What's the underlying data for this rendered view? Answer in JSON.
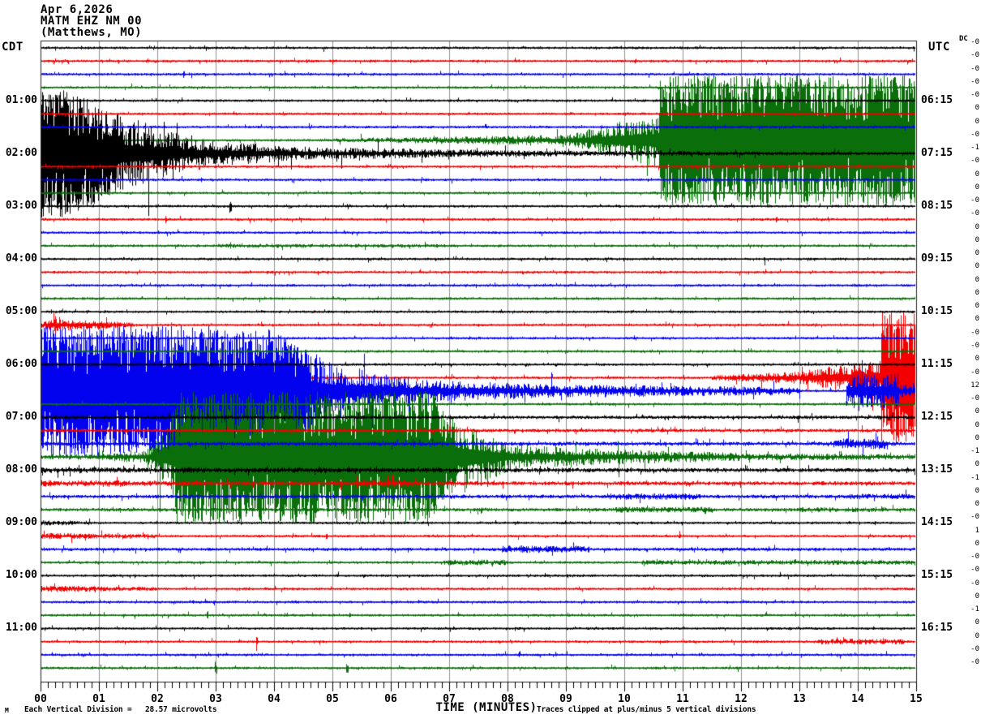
{
  "header": {
    "date": "Apr 6,2026",
    "station": "MATM EHZ NM 00",
    "location": "(Matthews, MO)"
  },
  "axes": {
    "left_timezone": "CDT",
    "right_timezone": "UTC",
    "dc_header": "DC",
    "left_labels": [
      {
        "row": 4,
        "text": "01:00"
      },
      {
        "row": 8,
        "text": "02:00"
      },
      {
        "row": 12,
        "text": "03:00"
      },
      {
        "row": 16,
        "text": "04:00"
      },
      {
        "row": 20,
        "text": "05:00"
      },
      {
        "row": 24,
        "text": "06:00"
      },
      {
        "row": 28,
        "text": "07:00"
      },
      {
        "row": 32,
        "text": "08:00"
      },
      {
        "row": 36,
        "text": "09:00"
      },
      {
        "row": 40,
        "text": "10:00"
      },
      {
        "row": 44,
        "text": "11:00"
      }
    ],
    "right_labels": [
      {
        "row": 4,
        "text": "06:15"
      },
      {
        "row": 8,
        "text": "07:15"
      },
      {
        "row": 12,
        "text": "08:15"
      },
      {
        "row": 16,
        "text": "09:15"
      },
      {
        "row": 20,
        "text": "10:15"
      },
      {
        "row": 24,
        "text": "11:15"
      },
      {
        "row": 28,
        "text": "12:15"
      },
      {
        "row": 32,
        "text": "13:15"
      },
      {
        "row": 36,
        "text": "14:15"
      },
      {
        "row": 40,
        "text": "15:15"
      },
      {
        "row": 44,
        "text": "16:15"
      }
    ],
    "x_labels": [
      "00",
      "01",
      "02",
      "03",
      "04",
      "05",
      "06",
      "07",
      "08",
      "09",
      "10",
      "11",
      "12",
      "13",
      "14",
      "15"
    ],
    "x_title": "TIME (MINUTES)"
  },
  "footer": {
    "logo_mark": "M",
    "left_note": "Each Vertical Division =   28.57 microvolts",
    "right_note": "Traces clipped at plus/minus 5 vertical divisions"
  },
  "chart_data": {
    "type": "line",
    "variant": "helicorder-seismogram",
    "title": "MATM EHZ NM 00 (Matthews, MO) Apr 6,2026",
    "xlabel": "TIME (MINUTES)",
    "x_range_minutes": [
      0,
      15
    ],
    "minutes_per_row": 15,
    "rows_count": 48,
    "row_cycle_colors": [
      "black",
      "red",
      "blue",
      "green"
    ],
    "colors": {
      "black": "#000000",
      "red": "#f40000",
      "blue": "#0202ee",
      "green": "#0a6e0a",
      "grid": "#8f8f8f",
      "border": "#222222"
    },
    "clip_divisions": 5,
    "microvolts_per_division": 28.57,
    "rows": [
      {
        "dc": "-0",
        "spikes": [
          [
            10.2,
            3.5
          ]
        ]
      },
      {
        "dc": "-0"
      },
      {
        "dc": "-0",
        "spikes": [
          [
            2.45,
            5
          ]
        ]
      },
      {
        "dc": "-0"
      },
      {
        "dc": "-0"
      },
      {
        "dc": "0"
      },
      {
        "dc": "0"
      },
      {
        "dc": "-0",
        "env": [
          [
            5,
            9,
            2.2,
            7
          ],
          [
            9,
            10.6,
            7,
            35
          ],
          [
            10.6,
            15,
            81,
            81
          ]
        ]
      },
      {
        "dc": "-1",
        "env": [
          [
            0,
            0.4,
            81,
            81
          ],
          [
            0.4,
            1.1,
            81,
            55
          ],
          [
            1.1,
            2.6,
            55,
            18
          ],
          [
            2.6,
            4.5,
            18,
            8
          ],
          [
            4.5,
            8,
            8,
            4
          ],
          [
            8,
            12,
            4,
            2.5
          ],
          [
            12,
            15,
            2.5,
            2
          ]
        ]
      },
      {
        "dc": "-0",
        "spikes": [
          [
            0.9,
            4
          ]
        ]
      },
      {
        "dc": "0"
      },
      {
        "dc": "0",
        "spikes": [
          [
            0.35,
            6
          ]
        ]
      },
      {
        "dc": "-0",
        "spikes": [
          [
            3.25,
            11
          ]
        ]
      },
      {
        "dc": "-0",
        "spikes": [
          [
            0.8,
            4
          ],
          [
            2.15,
            7
          ],
          [
            12.6,
            4
          ]
        ]
      },
      {
        "dc": "0"
      },
      {
        "dc": "0",
        "env": [
          [
            3,
            7,
            2.4,
            2.2
          ]
        ]
      },
      {
        "dc": "0",
        "spikes": [
          [
            12.4,
            4
          ]
        ]
      },
      {
        "dc": "0",
        "spikes": [
          [
            6.5,
            4
          ]
        ]
      },
      {
        "dc": "0"
      },
      {
        "dc": "0",
        "spikes": [
          [
            8.5,
            3
          ]
        ]
      },
      {
        "dc": "0"
      },
      {
        "dc": "0",
        "env": [
          [
            0,
            0.2,
            3,
            8
          ],
          [
            0.2,
            1.6,
            8,
            3
          ]
        ],
        "spikes": [
          [
            0.25,
            14
          ],
          [
            1.0,
            8
          ]
        ]
      },
      {
        "dc": "-0"
      },
      {
        "dc": "-0"
      },
      {
        "dc": "0"
      },
      {
        "dc": "-0",
        "env": [
          [
            11.5,
            13,
            3,
            8
          ],
          [
            13,
            14.4,
            8,
            25
          ],
          [
            14.4,
            15,
            81,
            81
          ]
        ]
      },
      {
        "dc": "12",
        "env": [
          [
            0,
            3.8,
            81,
            81
          ],
          [
            3.8,
            5,
            81,
            35
          ],
          [
            5,
            6.5,
            35,
            14
          ],
          [
            6.5,
            9,
            14,
            8
          ],
          [
            9,
            13,
            8,
            5
          ],
          [
            13.8,
            14.7,
            22,
            22
          ],
          [
            14.7,
            15,
            8,
            8
          ]
        ]
      },
      {
        "dc": "-0"
      },
      {
        "dc": "0",
        "env": [
          [
            0,
            15,
            2.2,
            2.2
          ]
        ]
      },
      {
        "dc": "0",
        "env": [
          [
            0,
            15,
            2.2,
            2.2
          ]
        ]
      },
      {
        "dc": "0",
        "env": [
          [
            0,
            15,
            2.5,
            2.5
          ],
          [
            13.6,
            14.5,
            7,
            7
          ]
        ]
      },
      {
        "dc": "-1",
        "env": [
          [
            0,
            1,
            3,
            4
          ],
          [
            1,
            1.8,
            4,
            8
          ],
          [
            1.8,
            2.3,
            8,
            50
          ],
          [
            2.3,
            6.8,
            81,
            81
          ],
          [
            6.8,
            8,
            60,
            18
          ],
          [
            8,
            10,
            15,
            9
          ],
          [
            10,
            12,
            9,
            5
          ],
          [
            12,
            15,
            4.5,
            3.5
          ]
        ]
      },
      {
        "dc": "0",
        "env": [
          [
            0,
            15,
            3.5,
            2.5
          ]
        ]
      },
      {
        "dc": "-1",
        "env": [
          [
            0,
            2.7,
            4,
            3
          ],
          [
            2.7,
            15,
            2.5,
            2.5
          ],
          [
            5.4,
            6.3,
            4,
            4
          ]
        ],
        "spikes": [
          [
            5.15,
            9
          ]
        ]
      },
      {
        "dc": "0",
        "env": [
          [
            0,
            15,
            2.2,
            2.2
          ],
          [
            9.7,
            11.3,
            4,
            4
          ],
          [
            13.8,
            15,
            3.5,
            3.5
          ]
        ],
        "spikes": [
          [
            7.9,
            5
          ]
        ]
      },
      {
        "dc": "0",
        "env": [
          [
            0,
            15,
            2.2,
            2.2
          ],
          [
            9.8,
            11.5,
            3.5,
            3.5
          ],
          [
            13,
            14.5,
            3.2,
            3.2
          ]
        ],
        "spikes": [
          [
            7.55,
            6
          ]
        ]
      },
      {
        "dc": "-0",
        "env": [
          [
            0,
            0.9,
            3.5,
            2
          ]
        ],
        "spikes": [
          [
            14.3,
            3
          ]
        ]
      },
      {
        "dc": "1",
        "env": [
          [
            0,
            2,
            4,
            2.5
          ]
        ],
        "spikes": [
          [
            4.9,
            5
          ],
          [
            10.95,
            7
          ]
        ]
      },
      {
        "dc": "0",
        "env": [
          [
            0,
            15,
            2,
            2
          ],
          [
            7.9,
            9.4,
            4.5,
            4.5
          ]
        ],
        "spikes": [
          [
            11.2,
            4
          ]
        ]
      },
      {
        "dc": "-0",
        "env": [
          [
            6.9,
            8,
            3.5,
            3.5
          ],
          [
            10.3,
            15,
            3,
            3
          ]
        ]
      },
      {
        "dc": "-0"
      },
      {
        "dc": "-0",
        "env": [
          [
            0,
            2,
            4,
            2.5
          ]
        ]
      },
      {
        "dc": "0",
        "spikes": [
          [
            2.6,
            4
          ]
        ]
      },
      {
        "dc": "-1",
        "spikes": [
          [
            2.85,
            6
          ],
          [
            5.3,
            4
          ]
        ]
      },
      {
        "dc": "0"
      },
      {
        "dc": "0",
        "env": [
          [
            13.3,
            14.8,
            3.5,
            3.5
          ]
        ],
        "spikes": [
          [
            3.7,
            12
          ]
        ]
      },
      {
        "dc": "-0",
        "spikes": [
          [
            8.2,
            5
          ]
        ]
      },
      {
        "dc": "-0",
        "spikes": [
          [
            3.0,
            7
          ],
          [
            5.25,
            12
          ],
          [
            7.4,
            4
          ]
        ]
      }
    ]
  }
}
